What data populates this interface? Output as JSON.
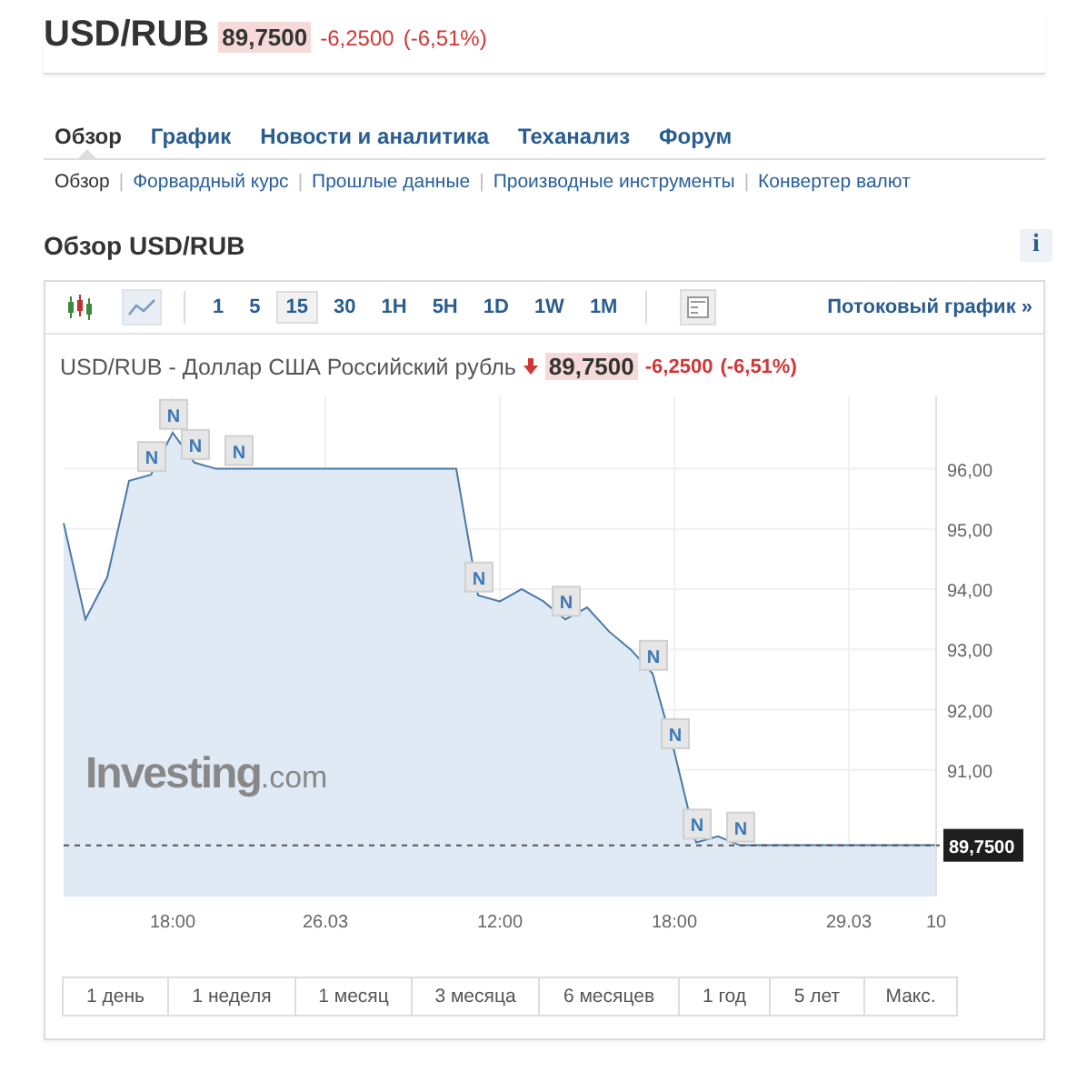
{
  "header": {
    "symbol": "USD/RUB",
    "price": "89,7500",
    "change": "-6,2500",
    "change_pct": "(-6,51%)"
  },
  "tabs": [
    {
      "label": "Обзор",
      "selected": true
    },
    {
      "label": "График",
      "selected": false
    },
    {
      "label": "Новости и аналитика",
      "selected": false
    },
    {
      "label": "Теханализ",
      "selected": false
    },
    {
      "label": "Форум",
      "selected": false
    }
  ],
  "subnav": [
    {
      "kind": "link",
      "label": "Обзор",
      "selected": true
    },
    {
      "kind": "separator",
      "label": "|"
    },
    {
      "kind": "link",
      "label": "Форвардный курс",
      "selected": false
    },
    {
      "kind": "separator",
      "label": "|"
    },
    {
      "kind": "link",
      "label": "Прошлые данные",
      "selected": false
    },
    {
      "kind": "separator",
      "label": "|"
    },
    {
      "kind": "link",
      "label": "Производные инструменты",
      "selected": false
    },
    {
      "kind": "separator",
      "label": "|"
    },
    {
      "kind": "link",
      "label": "Конвертер валют",
      "selected": false
    }
  ],
  "section": {
    "title": "Обзор USD/RUB",
    "info": "i"
  },
  "toolbar": {
    "chart_types": [
      {
        "kind": "candles",
        "selected": false
      },
      {
        "kind": "line",
        "selected": true
      }
    ],
    "intervals": [
      {
        "label": "1",
        "selected": false
      },
      {
        "label": "5",
        "selected": false
      },
      {
        "label": "15",
        "selected": true
      },
      {
        "label": "30",
        "selected": false
      },
      {
        "label": "1H",
        "selected": false
      },
      {
        "label": "5H",
        "selected": false
      },
      {
        "label": "1D",
        "selected": false
      },
      {
        "label": "1W",
        "selected": false
      },
      {
        "label": "1M",
        "selected": false
      }
    ],
    "streaming_link": "Потоковый график »"
  },
  "chart": {
    "title": "USD/RUB - Доллар США Российский рубль",
    "price": "89,7500",
    "change": "-6,2500",
    "change_pct": "(-6,51%)",
    "logo": {
      "name": "Investing",
      "suffix": ".com"
    },
    "news_markers": [
      {
        "text": "N"
      },
      {
        "text": "N"
      },
      {
        "text": "N"
      },
      {
        "text": "N"
      },
      {
        "text": "N"
      },
      {
        "text": "N"
      },
      {
        "text": "N"
      },
      {
        "text": "N"
      },
      {
        "text": "N"
      },
      {
        "text": "N"
      }
    ],
    "chart_data": {
      "type": "area",
      "grid": true,
      "categories": [
        null,
        null,
        null,
        null,
        null,
        "18:00",
        null,
        null,
        null,
        null,
        null,
        null,
        "26.03",
        null,
        null,
        null,
        null,
        null,
        null,
        null,
        "12:00",
        null,
        null,
        null,
        null,
        null,
        null,
        null,
        "18:00",
        null,
        null,
        null,
        null,
        null,
        null,
        null,
        "29.03",
        null,
        null,
        null,
        "10"
      ],
      "series": [
        {
          "color": "#4a79a8",
          "values": [
            95.1,
            93.5,
            94.2,
            95.8,
            95.9,
            96.6,
            96.1,
            96.0,
            96.0,
            96.0,
            96.0,
            96.0,
            96.0,
            96.0,
            96.0,
            96.0,
            96.0,
            96.0,
            96.0,
            93.9,
            93.8,
            94.0,
            93.8,
            93.5,
            93.7,
            93.3,
            93.0,
            92.6,
            91.3,
            89.8,
            89.9,
            89.75,
            89.75,
            89.75,
            89.75,
            89.75,
            89.75,
            89.75,
            89.75,
            89.75,
            89.75
          ]
        }
      ],
      "ylim": [
        88.9,
        97.2
      ],
      "ref_lines": [
        {
          "axis": "y",
          "value": 89.75,
          "label": "89,7500"
        }
      ],
      "yticks": [
        {
          "value": 91,
          "label": "91,00"
        },
        {
          "value": 92,
          "label": "92,00"
        },
        {
          "value": 93,
          "label": "93,00"
        },
        {
          "value": 94,
          "label": "94,00"
        },
        {
          "value": 95,
          "label": "95,00"
        },
        {
          "value": 96,
          "label": "96,00"
        }
      ]
    }
  },
  "ranges": [
    "1 день",
    "1 неделя",
    "1 месяц",
    "3 месяца",
    "6 месяцев",
    "1 год",
    "5 лет",
    "Макс."
  ]
}
